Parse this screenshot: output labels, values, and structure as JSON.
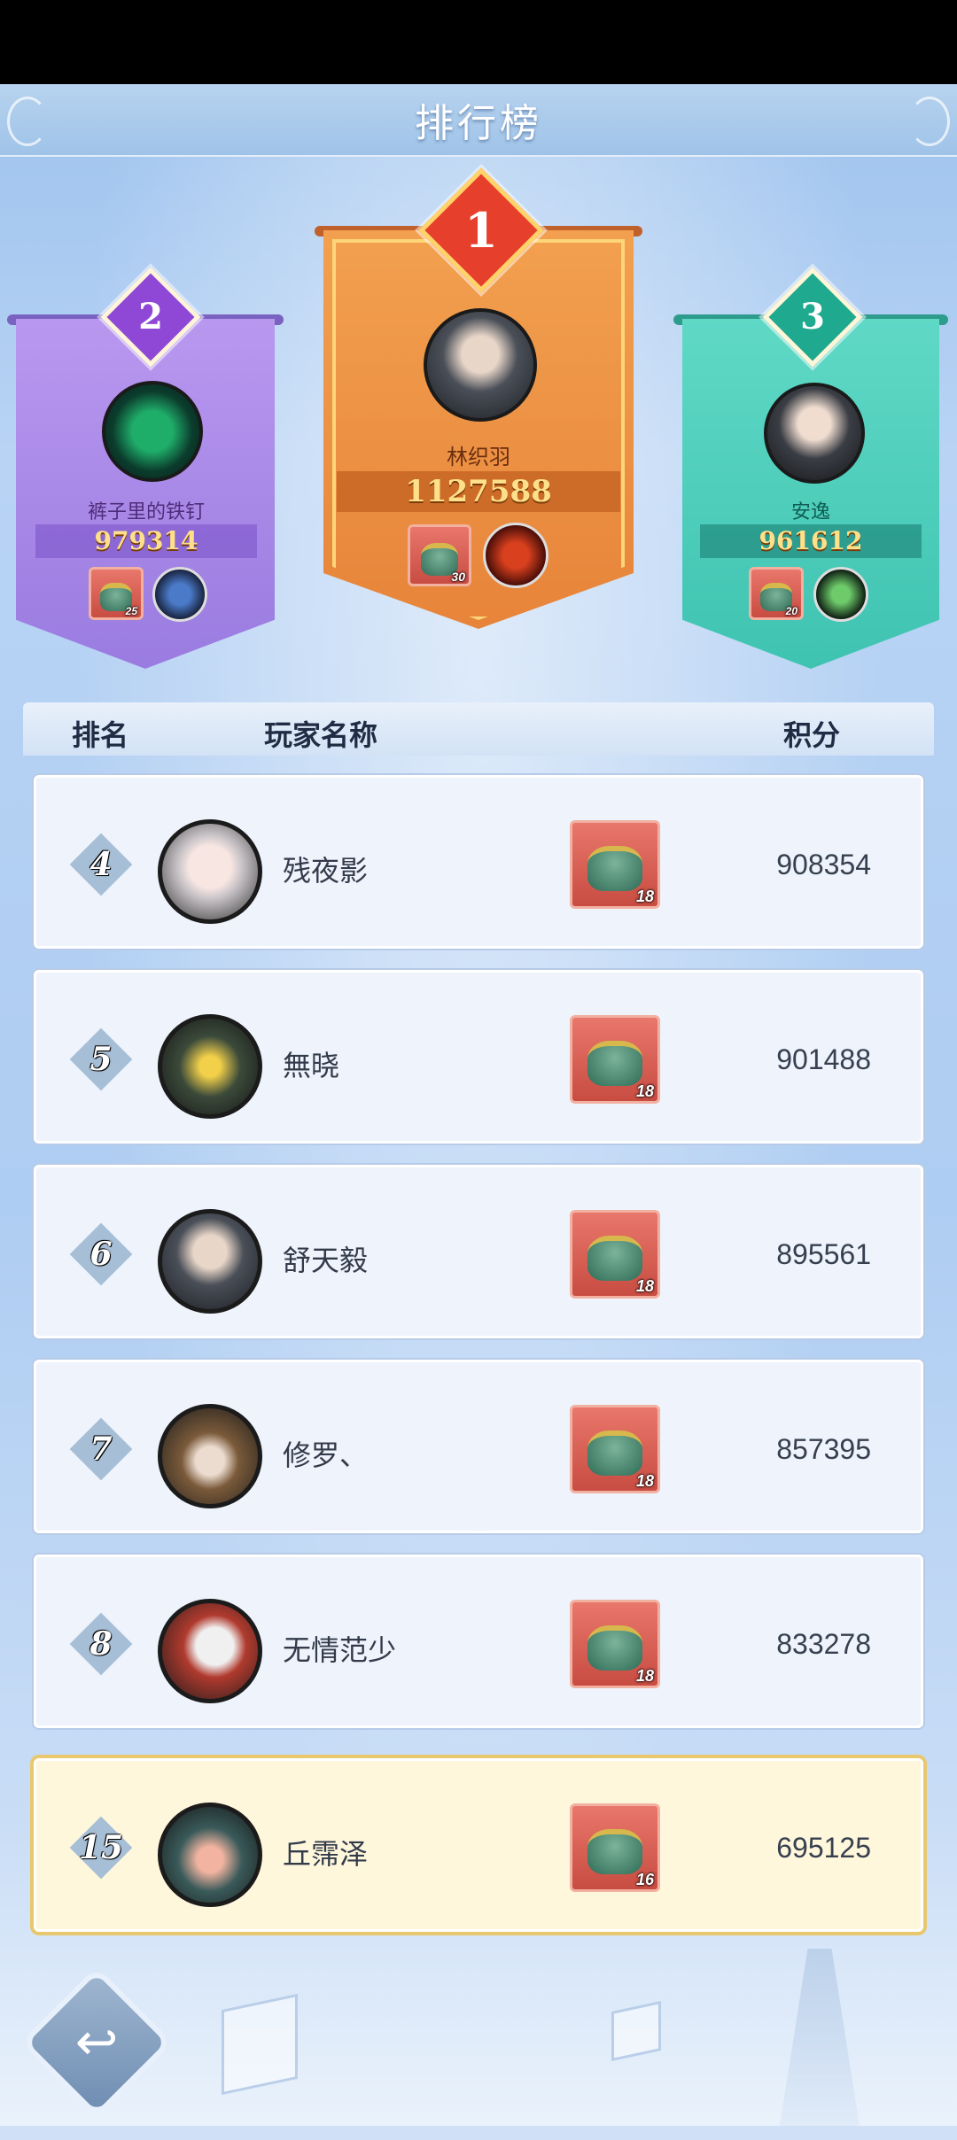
{
  "title": "排行榜",
  "podium": [
    {
      "rank": "2",
      "name": "裤子里的铁钉",
      "score": "979314",
      "item_count": "25"
    },
    {
      "rank": "1",
      "name": "林织羽",
      "score": "1127588",
      "item_count": "30"
    },
    {
      "rank": "3",
      "name": "安逸",
      "score": "961612",
      "item_count": "20"
    }
  ],
  "table": {
    "headers": {
      "rank": "排名",
      "player": "玩家名称",
      "score": "积分"
    },
    "rows": [
      {
        "rank": "4",
        "name": "残夜影",
        "item_count": "18",
        "score": "908354"
      },
      {
        "rank": "5",
        "name": "無晓",
        "item_count": "18",
        "score": "901488"
      },
      {
        "rank": "6",
        "name": "舒天毅",
        "item_count": "18",
        "score": "895561"
      },
      {
        "rank": "7",
        "name": "修罗、",
        "item_count": "18",
        "score": "857395"
      },
      {
        "rank": "8",
        "name": "无情范少",
        "item_count": "18",
        "score": "833278"
      }
    ],
    "me": {
      "rank": "15",
      "name": "丘霈泽",
      "item_count": "16",
      "score": "695125"
    }
  },
  "icons": {
    "back": "back-arrow-icon",
    "item": "cauldron-icon"
  },
  "colors": {
    "gold": "#e7843a",
    "silver": "#9a7be0",
    "bronze": "#3fc3b1",
    "highlight_row": "#fff7dc"
  }
}
